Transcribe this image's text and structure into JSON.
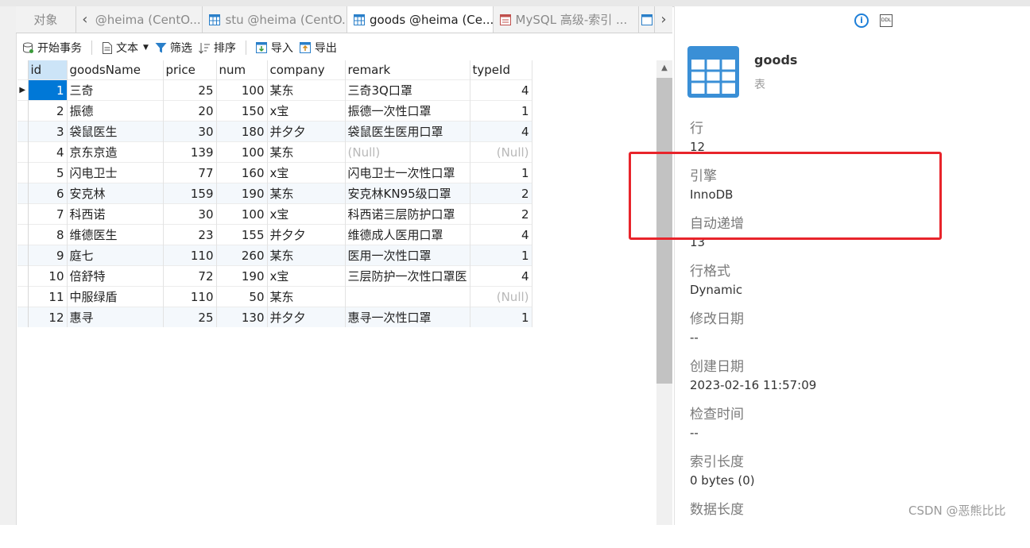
{
  "tabs": [
    {
      "label": "对象",
      "icon": "none"
    },
    {
      "label": "@heima (CentO...",
      "icon": "table-icon"
    },
    {
      "label": "stu @heima (CentO...",
      "icon": "table-icon"
    },
    {
      "label": "goods @heima (Ce...",
      "icon": "table-icon",
      "active": true
    },
    {
      "label": "MySQL 高级-索引 ...",
      "icon": "query-icon"
    }
  ],
  "toolbar": {
    "begin_transaction": "开始事务",
    "text": "文本",
    "filter": "筛选",
    "sort": "排序",
    "import": "导入",
    "export": "导出"
  },
  "grid": {
    "columns": [
      "id",
      "goodsName",
      "price",
      "num",
      "company",
      "remark",
      "typeId"
    ],
    "rows": [
      [
        "1",
        "三奇",
        "25",
        "100",
        "某东",
        "三奇3Q口罩",
        "4"
      ],
      [
        "2",
        "振德",
        "20",
        "150",
        "x宝",
        "振德一次性口罩",
        "1"
      ],
      [
        "3",
        "袋鼠医生",
        "30",
        "180",
        "并夕夕",
        "袋鼠医生医用口罩",
        "4"
      ],
      [
        "4",
        "京东京造",
        "139",
        "100",
        "某东",
        "(Null)",
        "(Null)"
      ],
      [
        "5",
        "闪电卫士",
        "77",
        "160",
        "x宝",
        "闪电卫士一次性口罩",
        "1"
      ],
      [
        "6",
        "安克林",
        "159",
        "190",
        "某东",
        "安克林KN95级口罩",
        "2"
      ],
      [
        "7",
        "科西诺",
        "30",
        "100",
        "x宝",
        "科西诺三层防护口罩",
        "2"
      ],
      [
        "8",
        "维德医生",
        "23",
        "155",
        "并夕夕",
        "维德成人医用口罩",
        "4"
      ],
      [
        "9",
        "庭七",
        "110",
        "260",
        "某东",
        "医用一次性口罩",
        "1"
      ],
      [
        "10",
        "倍舒特",
        "72",
        "190",
        "x宝",
        "三层防护一次性口罩医",
        "4"
      ],
      [
        "11",
        "中服绿盾",
        "110",
        "50",
        "某东",
        "",
        "(Null)"
      ],
      [
        "12",
        "惠寻",
        "25",
        "130",
        "并夕夕",
        "惠寻一次性口罩",
        "1"
      ]
    ]
  },
  "info": {
    "name": "goods",
    "type": "表",
    "props": [
      {
        "label": "行",
        "value": "12"
      },
      {
        "label": "引擎",
        "value": "InnoDB"
      },
      {
        "label": "自动递增",
        "value": "13"
      },
      {
        "label": "行格式",
        "value": "Dynamic"
      },
      {
        "label": "修改日期",
        "value": "--"
      },
      {
        "label": "创建日期",
        "value": "2023-02-16 11:57:09"
      },
      {
        "label": "检查时间",
        "value": "--"
      },
      {
        "label": "索引长度",
        "value": "0 bytes (0)"
      },
      {
        "label": "数据长度",
        "value": ""
      }
    ]
  },
  "ddl_label": "DDL",
  "info_symbol": "i",
  "watermark": "CSDN @恶熊比比",
  "colors": {
    "selection": "#0078d7",
    "highlight": "#e8242b",
    "info": "#1e7fd8"
  }
}
